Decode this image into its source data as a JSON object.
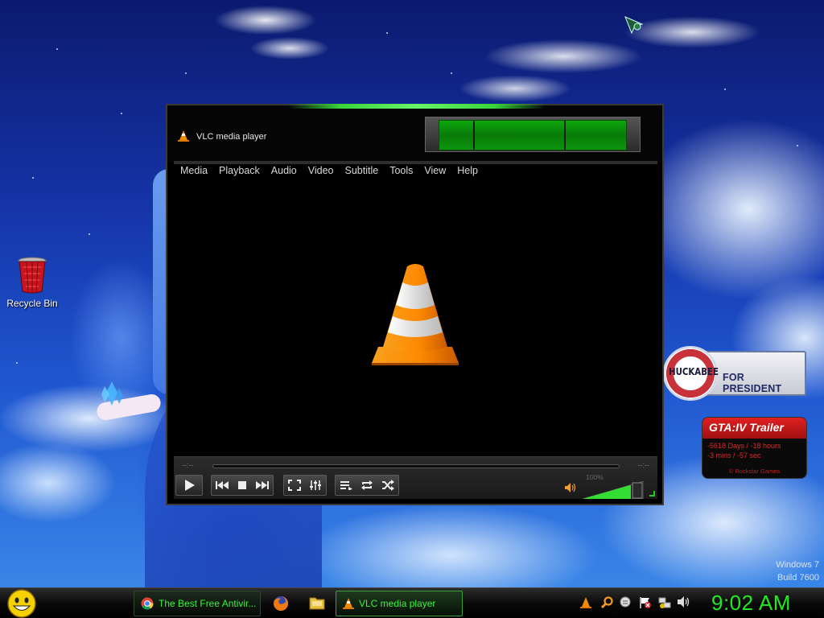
{
  "desktop": {
    "icons": [
      {
        "label": "Recycle Bin",
        "icon": "recycle-bin-icon"
      }
    ],
    "watermark": {
      "line1": "Windows 7",
      "line2": "Build 7600"
    }
  },
  "gadgets": {
    "huckabee": {
      "badge": "HUCKABEE",
      "text": "FOR PRESIDENT"
    },
    "gta": {
      "title": "GTA:IV Trailer",
      "line1": "-5618 Days / -18 hours",
      "line2": "-3 mins / -57 sec",
      "footer": "© Rockstar Games"
    }
  },
  "vlc": {
    "title": "VLC media player",
    "menu": [
      "Media",
      "Playback",
      "Audio",
      "Video",
      "Subtitle",
      "Tools",
      "View",
      "Help"
    ],
    "time_elapsed": "--:--",
    "time_remaining": "--:--",
    "volume_label": "100%",
    "volume_level": 1.0,
    "accent_color": "#33dd33"
  },
  "taskbar": {
    "buttons": [
      {
        "label": "The Best Free Antivir...",
        "icon": "chrome-icon"
      },
      {
        "label": "VLC media player",
        "icon": "vlc-cone-icon",
        "active": true
      }
    ],
    "quick_launch": [
      "firefox-icon",
      "folder-icon"
    ],
    "tray": [
      "vlc-tray-icon",
      "search-tray-icon",
      "messenger-tray-icon",
      "flag-tray-icon",
      "network-tray-icon",
      "volume-tray-icon"
    ],
    "clock": "9:02 AM"
  }
}
